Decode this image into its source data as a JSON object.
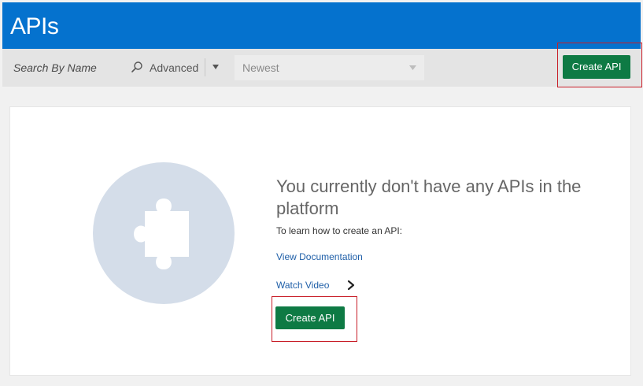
{
  "header": {
    "title": "APIs"
  },
  "toolbar": {
    "search_placeholder": "Search By Name",
    "advanced_label": "Advanced",
    "sort_value": "Newest",
    "create_label": "Create API"
  },
  "empty_state": {
    "title": "You currently don't have any APIs in the platform",
    "learn_text": "To learn how to create an API:",
    "doc_link": "View Documentation",
    "video_link": "Watch Video",
    "create_label": "Create API"
  },
  "colors": {
    "header_bg": "#0572ce",
    "button_green": "#0e7a44",
    "link_blue": "#1f5fa8",
    "illustration_circle": "#d4dde9",
    "highlight_red": "#c81e28"
  },
  "icons": {
    "search": "search-icon",
    "advanced_caret": "caret-down-icon",
    "sort_caret": "caret-down-icon",
    "video_chevron": "chevron-right-icon",
    "illustration": "puzzle-piece-icon"
  }
}
